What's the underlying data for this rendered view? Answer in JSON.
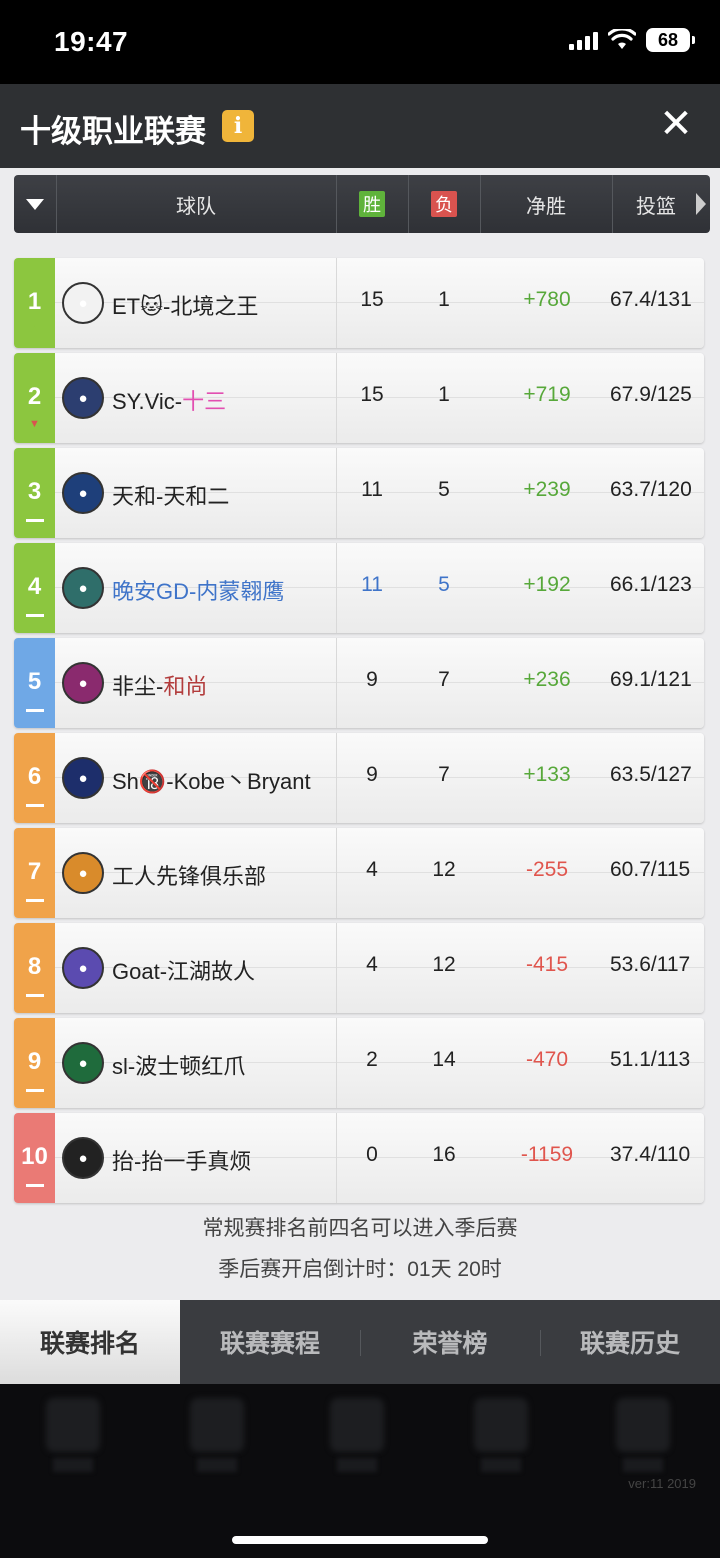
{
  "status_bar": {
    "time": "19:47",
    "battery": "68"
  },
  "header": {
    "title": "十级职业联赛",
    "info_icon": "i",
    "close_icon": "✕"
  },
  "columns": {
    "team": "球队",
    "win": "胜",
    "loss": "负",
    "net": "净胜",
    "shot": "投篮"
  },
  "teams": [
    {
      "rank": "1",
      "trend": "▲",
      "name_a": "ET🐱-北境之王",
      "name_b": "",
      "wins": "15",
      "losses": "1",
      "net": "+780",
      "shot": "67.4/131",
      "rank_color": "#8cc63f",
      "trend_color": "#8cc63f",
      "logo_color": "#f2f2f2"
    },
    {
      "rank": "2",
      "trend": "▼",
      "name_a": "SY.Vic-",
      "name_b": "十三",
      "wins": "15",
      "losses": "1",
      "net": "+719",
      "shot": "67.9/125",
      "rank_color": "#8cc63f",
      "trend_color": "#d9534f",
      "logo_color": "#2c3e70"
    },
    {
      "rank": "3",
      "trend": "—",
      "name_a": "天和-天和二",
      "name_b": "",
      "wins": "11",
      "losses": "5",
      "net": "+239",
      "shot": "63.7/120",
      "rank_color": "#8cc63f",
      "logo_color": "#1e3f7a"
    },
    {
      "rank": "4",
      "trend": "—",
      "name_a": "晚安GD-内蒙翱鹰",
      "name_b": "",
      "wins": "11",
      "losses": "5",
      "net": "+192",
      "shot": "66.1/123",
      "rank_color": "#8cc63f",
      "logo_color": "#2f6e6a"
    },
    {
      "rank": "5",
      "trend": "—",
      "name_a": "非尘-",
      "name_b": "和尚",
      "wins": "9",
      "losses": "7",
      "net": "+236",
      "shot": "69.1/121",
      "rank_color": "#6fa8e6",
      "logo_color": "#8a2a6e"
    },
    {
      "rank": "6",
      "trend": "—",
      "name_a": "Sh🔞-Kobe丶Bryant",
      "name_b": "",
      "wins": "9",
      "losses": "7",
      "net": "+133",
      "shot": "63.5/127",
      "rank_color": "#f0a34a",
      "logo_color": "#1d2e6b"
    },
    {
      "rank": "7",
      "trend": "—",
      "name_a": "工人先锋俱乐部",
      "name_b": "",
      "wins": "4",
      "losses": "12",
      "net": "-255",
      "shot": "60.7/115",
      "rank_color": "#f0a34a",
      "logo_color": "#d98b2b"
    },
    {
      "rank": "8",
      "trend": "—",
      "name_a": "Goat-江湖故人",
      "name_b": "",
      "wins": "4",
      "losses": "12",
      "net": "-415",
      "shot": "53.6/117",
      "rank_color": "#f0a34a",
      "logo_color": "#5b4bb0"
    },
    {
      "rank": "9",
      "trend": "—",
      "name_a": "sl-波士顿红爪",
      "name_b": "",
      "wins": "2",
      "losses": "14",
      "net": "-470",
      "shot": "51.1/113",
      "rank_color": "#f0a34a",
      "logo_color": "#1f6b3c"
    },
    {
      "rank": "10",
      "trend": "—",
      "name_a": "抬-抬一手真烦",
      "name_b": "",
      "wins": "0",
      "losses": "16",
      "net": "-1159",
      "shot": "37.4/110",
      "rank_color": "#ea7a75",
      "logo_color": "#222222"
    }
  ],
  "notes": {
    "playoff": "常规赛排名前四名可以进入季后赛",
    "countdown": "季后赛开启倒计时：01天 20时"
  },
  "tabs": [
    "联赛排名",
    "联赛赛程",
    "荣誉榜",
    "联赛历史"
  ],
  "version": "ver:11  2019"
}
